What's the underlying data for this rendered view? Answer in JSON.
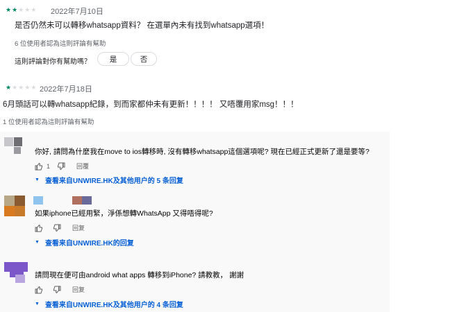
{
  "reviews": [
    {
      "stars_filled": 2,
      "stars_total": 5,
      "date": "2022年7月10日",
      "text": "是否仍然未可以轉移whatsapp資料？ 在選單內未有找到whatsapp選項！",
      "helpful": "6 位使用者認為這則評論有幫助",
      "question": "這則評論對你有幫助嗎？",
      "yes_label": "是",
      "no_label": "否"
    },
    {
      "stars_filled": 1,
      "stars_total": 5,
      "date": "2022年7月18日",
      "text": "6月頭話可以轉whatsapp紀錄，到而家都仲未有更新！！！！ 又唔覆用家msg！！！",
      "helpful": "1 位使用者認為這則評論有幫助"
    }
  ],
  "comments": [
    {
      "text": "你好, 請問為什麼我在move to ios轉移時, 沒有轉移whatsapp這個選項呢? 現在已經正式更新了還是要等?",
      "like_count": "1",
      "reply_label": "回覆",
      "replies_label": "查看来自UNWIRE.HK及其他用户的 5 条回复"
    },
    {
      "text": "如果iphone已經用緊，淨係想轉WhatsApp 又得唔得呢?",
      "like_count": "",
      "reply_label": "回复",
      "replies_label": "查看来自UNWIRE.HK的回复"
    },
    {
      "text": "請問現在便可由android what apps 轉移到iPhone? 請教教， 謝謝",
      "like_count": "",
      "reply_label": "回复",
      "replies_label": "查看来自UNWIRE.HK及其他用户的 4 条回复"
    }
  ],
  "colors": {
    "star_on": "#01875f",
    "star_off": "#dadce0",
    "link_blue": "#065fd4",
    "panel_bg": "#f9f9f9"
  },
  "icons": [
    "star-icon",
    "thumb-up-icon",
    "thumb-down-icon",
    "caret-down-icon"
  ]
}
